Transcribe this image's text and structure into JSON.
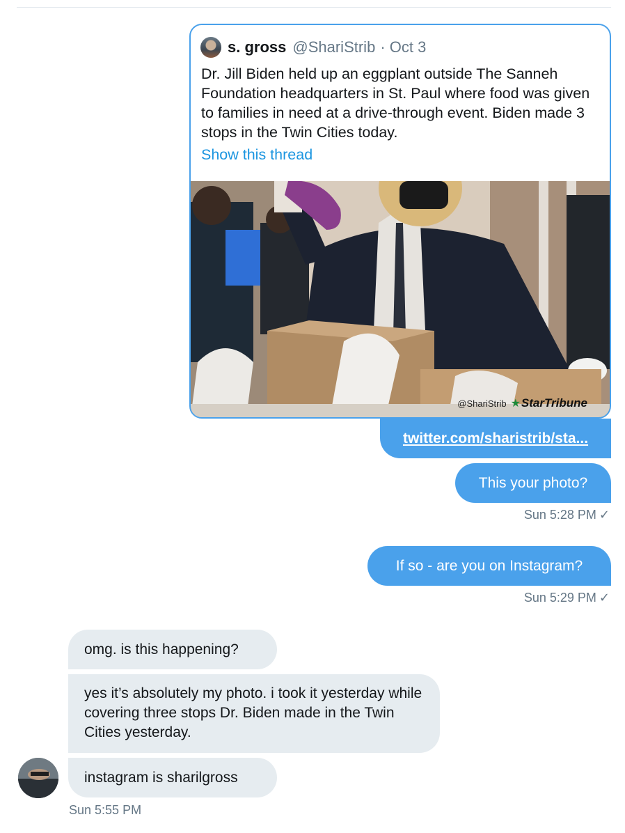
{
  "quoted_tweet": {
    "display_name": "s. gross",
    "handle": "@ShariStrib",
    "date": "· Oct 3",
    "text": "Dr. Jill Biden held up an eggplant outside The Sanneh Foundation headquarters in St. Paul where food was given to families in need at a drive-through event. Biden made 3 stops in the Twin Cities today.",
    "thread_link": "Show this thread",
    "photo_watermark_handle": "@ShariStrib",
    "photo_watermark_brand": "StarTribune"
  },
  "messages": {
    "link_text": "twitter.com/sharistrib/sta...",
    "outgoing_1": "This your photo?",
    "outgoing_1_time": "Sun 5:28 PM",
    "outgoing_2": "If so - are you on Instagram?",
    "outgoing_2_time": "Sun 5:29 PM",
    "incoming_1": "omg. is this happening?",
    "incoming_2": "yes it’s absolutely my photo. i took it yesterday while covering three stops Dr. Biden made in the Twin Cities yesterday.",
    "incoming_3": "instagram is sharilgross",
    "incoming_time": "Sun 5:55 PM"
  },
  "icons": {
    "read_receipt": "checkmark-icon",
    "watermark_star": "star-icon"
  },
  "colors": {
    "outgoing_bubble": "#4aa1eb",
    "incoming_bubble": "#e6ecf0",
    "link": "#1b95e0",
    "meta_text": "#657786"
  }
}
